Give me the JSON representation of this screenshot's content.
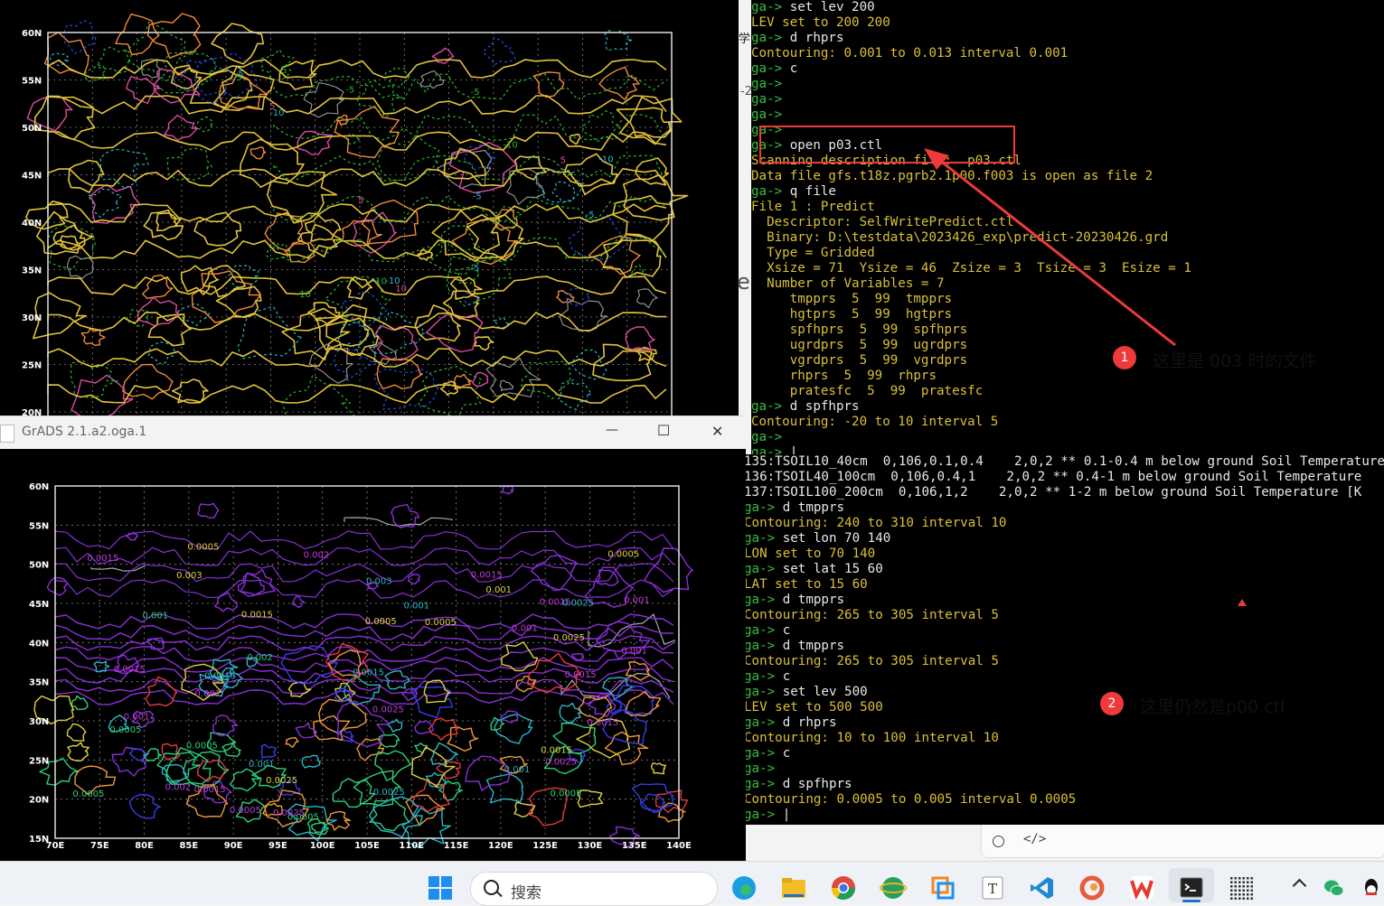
{
  "top_plot": {
    "lat_labels": [
      "60N",
      "55N",
      "50N",
      "45N",
      "40N",
      "35N",
      "30N",
      "25N",
      "20N"
    ],
    "contour_labels": [
      "-5",
      "-5",
      "-5",
      "-5",
      "-10",
      "-5",
      "5",
      "-10",
      "-10",
      "10",
      "-10",
      "5",
      "-5",
      "-10",
      "-5",
      "5",
      "-5",
      "-10"
    ]
  },
  "bottom_window": {
    "title": "GrADS 2.1.a2.oga.1",
    "minimize_glyph": "—",
    "maximize_glyph": "☐",
    "close_glyph": "✕"
  },
  "bottom_plot": {
    "lat_labels": [
      "60N",
      "55N",
      "50N",
      "45N",
      "40N",
      "35N",
      "30N",
      "25N",
      "20N",
      "15N"
    ],
    "lon_labels": [
      "70E",
      "75E",
      "80E",
      "85E",
      "90E",
      "95E",
      "100E",
      "105E",
      "110E",
      "115E",
      "120E",
      "125E",
      "130E",
      "135E",
      "140E"
    ],
    "contour_labels": [
      "0.001",
      "0.0005",
      "0.0005",
      "0.0005",
      "0.0005",
      "0.001",
      "0.0005",
      "0.0005",
      "0.001",
      "0.0015",
      "0.0005",
      "0.001",
      "0.0015",
      "0.0005",
      "0.0015",
      "0.002",
      "0.0015",
      "0.001",
      "0.0015",
      "0.0015",
      "0.001",
      "0.0015",
      "0.0025",
      "0.0025",
      "0.002",
      "0.0015",
      "0.0025",
      "0.0015",
      "0.001",
      "0.0005",
      "0.001",
      "0.0015",
      "0.0015",
      "0.0025",
      "0.001",
      "0.002",
      "0.003",
      "0.0025",
      "0.0025",
      "0.003",
      "0.0025",
      "0.001",
      "0.0005"
    ],
    "side_char_1": "学",
    "side_char_2": "-2",
    "side_char_3": "e"
  },
  "terminal_top": {
    "lines": [
      {
        "p": "ga->",
        "t": " set lev 200",
        "k": "cmd"
      },
      {
        "p": "",
        "t": "LEV set to 200 200",
        "k": "out"
      },
      {
        "p": "ga->",
        "t": " d rhprs",
        "k": "cmd"
      },
      {
        "p": "",
        "t": "Contouring: 0.001 to 0.013 interval 0.001",
        "k": "out"
      },
      {
        "p": "ga->",
        "t": " c",
        "k": "cmd"
      },
      {
        "p": "ga->",
        "t": "",
        "k": "cmd"
      },
      {
        "p": "ga->",
        "t": "",
        "k": "cmd"
      },
      {
        "p": "ga->",
        "t": "",
        "k": "cmd"
      },
      {
        "p": "ga->",
        "t": "",
        "k": "cmd"
      },
      {
        "p": "ga->",
        "t": " open p03.ctl",
        "k": "cmd"
      },
      {
        "p": "",
        "t": "Scanning description file:  p03.ctl",
        "k": "out"
      },
      {
        "p": "",
        "t": "Data file gfs.t18z.pgrb2.1p00.f003 is open as file 2",
        "k": "out"
      },
      {
        "p": "ga->",
        "t": " q file",
        "k": "cmd"
      },
      {
        "p": "",
        "t": "File 1 : Predict",
        "k": "out"
      },
      {
        "p": "",
        "t": "  Descriptor: SelfWritePredict.ctl",
        "k": "out"
      },
      {
        "p": "",
        "t": "  Binary: D:\\testdata\\2023426_exp\\predict-20230426.grd",
        "k": "out"
      },
      {
        "p": "",
        "t": "  Type = Gridded",
        "k": "out"
      },
      {
        "p": "",
        "t": "  Xsize = 71  Ysize = 46  Zsize = 3  Tsize = 3  Esize = 1",
        "k": "out"
      },
      {
        "p": "",
        "t": "  Number of Variables = 7",
        "k": "out"
      },
      {
        "p": "",
        "t": "     tmpprs  5  99  tmpprs",
        "k": "out"
      },
      {
        "p": "",
        "t": "     hgtprs  5  99  hgtprs",
        "k": "out"
      },
      {
        "p": "",
        "t": "     spfhprs  5  99  spfhprs",
        "k": "out"
      },
      {
        "p": "",
        "t": "     ugrdprs  5  99  ugrdprs",
        "k": "out"
      },
      {
        "p": "",
        "t": "     vgrdprs  5  99  vgrdprs",
        "k": "out"
      },
      {
        "p": "",
        "t": "     rhprs  5  99  rhprs",
        "k": "out"
      },
      {
        "p": "",
        "t": "     pratesfc  5  99  pratesfc",
        "k": "out"
      },
      {
        "p": "ga->",
        "t": " d spfhprs",
        "k": "cmd"
      },
      {
        "p": "",
        "t": "Contouring: -20 to 10 interval 5",
        "k": "out"
      },
      {
        "p": "ga->",
        "t": "",
        "k": "cmd"
      },
      {
        "p": "ga->",
        "t": " |",
        "k": "cmd"
      }
    ]
  },
  "terminal_bottom": {
    "lines": [
      {
        "p": "",
        "t": "135:TSOIL10_40cm  0,106,0.1,0.4    2,0,2 ** 0.1-0.4 m below ground Soil Temperature",
        "k": "white"
      },
      {
        "p": "",
        "t": "136:TSOIL40_100cm  0,106,0.4,1    2,0,2 ** 0.4-1 m below ground Soil Temperature",
        "k": "white"
      },
      {
        "p": "",
        "t": "137:TSOIL100_200cm  0,106,1,2    2,0,2 ** 1-2 m below ground Soil Temperature [K",
        "k": "white"
      },
      {
        "p": "ga->",
        "t": " d tmpprs",
        "k": "cmd"
      },
      {
        "p": "",
        "t": "Contouring: 240 to 310 interval 10",
        "k": "out"
      },
      {
        "p": "ga->",
        "t": " set lon 70 140",
        "k": "cmd"
      },
      {
        "p": "",
        "t": "LON set to 70 140",
        "k": "out"
      },
      {
        "p": "ga->",
        "t": " set lat 15 60",
        "k": "cmd"
      },
      {
        "p": "",
        "t": "LAT set to 15 60",
        "k": "out"
      },
      {
        "p": "ga->",
        "t": " d tmpprs",
        "k": "cmd"
      },
      {
        "p": "",
        "t": "Contouring: 265 to 305 interval 5",
        "k": "out"
      },
      {
        "p": "ga->",
        "t": " c",
        "k": "cmd"
      },
      {
        "p": "ga->",
        "t": " d tmpprs",
        "k": "cmd"
      },
      {
        "p": "",
        "t": "Contouring: 265 to 305 interval 5",
        "k": "out"
      },
      {
        "p": "ga->",
        "t": " c",
        "k": "cmd"
      },
      {
        "p": "ga->",
        "t": " set lev 500",
        "k": "cmd"
      },
      {
        "p": "",
        "t": "LEV set to 500 500",
        "k": "out"
      },
      {
        "p": "ga->",
        "t": " d rhprs",
        "k": "cmd"
      },
      {
        "p": "",
        "t": "Contouring: 10 to 100 interval 10",
        "k": "out"
      },
      {
        "p": "ga->",
        "t": " c",
        "k": "cmd"
      },
      {
        "p": "ga->",
        "t": "",
        "k": "cmd"
      },
      {
        "p": "ga->",
        "t": " d spfhprs",
        "k": "cmd"
      },
      {
        "p": "",
        "t": "Contouring: 0.0005 to 0.005 interval 0.0005",
        "k": "out"
      },
      {
        "p": "ga->",
        "t": " |",
        "k": "cmd"
      }
    ]
  },
  "annotations": [
    {
      "num": "1",
      "text": "这里是 003 时的文件"
    },
    {
      "num": "2",
      "text": "这里仍然是p00.ctl"
    }
  ],
  "colors": {
    "annotation_red": "#ee3a3a",
    "prompt_green": "#36c03a",
    "output_yellow": "#d9c03a"
  },
  "taskbar": {
    "search_placeholder": "搜索",
    "icons": [
      "windows-start-icon",
      "search-icon",
      "edge-icon",
      "file-explorer-icon",
      "chrome-icon",
      "globe-app-icon",
      "layered-app-icon",
      "text-editor-icon",
      "vscode-icon",
      "browser-swirl-icon",
      "wps-icon",
      "terminal-icon",
      "grid-app-icon",
      "tray-chevron-icon",
      "wechat-icon",
      "qq-icon"
    ]
  }
}
